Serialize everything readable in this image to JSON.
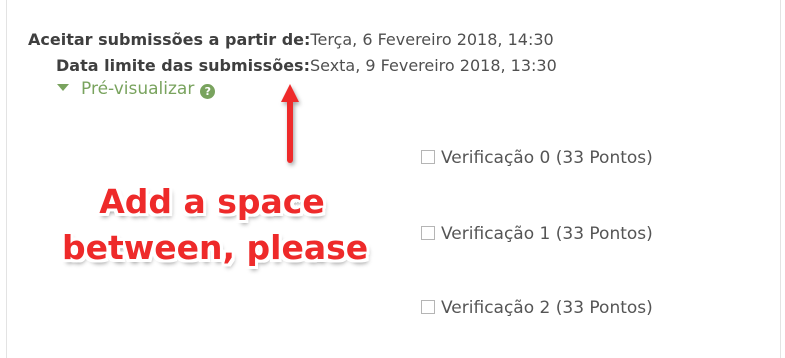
{
  "submission": {
    "accept_label": "Aceitar submissões a partir de:",
    "accept_value": "Terça, 6 Fevereiro 2018, 14:30",
    "deadline_label": "Data limite das submissões:",
    "deadline_value": "Sexta, 9 Fevereiro 2018, 13:30"
  },
  "preview": {
    "label": "Pré-visualizar",
    "help_icon": "?"
  },
  "checks": [
    {
      "label": "Verificação 0 (33 Pontos)"
    },
    {
      "label": "Verificação 1 (33 Pontos)"
    },
    {
      "label": "Verificação 2 (33 Pontos)"
    }
  ],
  "annotation": {
    "line1": "Add a space",
    "line2": "between, please",
    "color": "#ee2a2a"
  },
  "colors": {
    "accent_green": "#79a35e",
    "annotation_red": "#ee2a2a"
  }
}
